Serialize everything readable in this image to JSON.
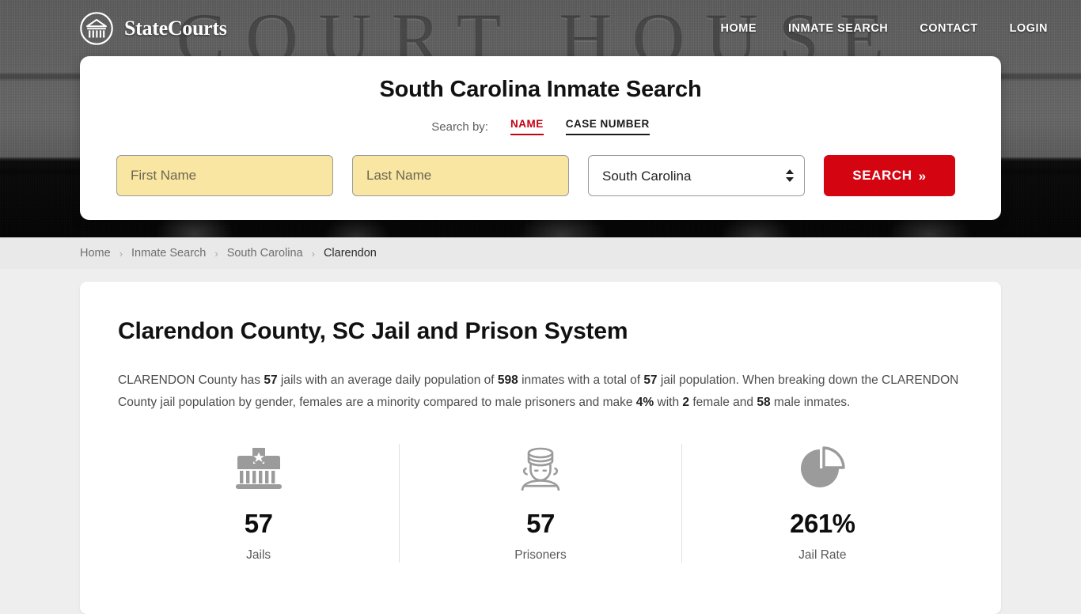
{
  "site": {
    "brand_name": "StateCourts",
    "logo_icon": "courthouse-circle-icon"
  },
  "nav": {
    "items": [
      {
        "label": "HOME"
      },
      {
        "label": "INMATE SEARCH"
      },
      {
        "label": "CONTACT"
      },
      {
        "label": "LOGIN"
      }
    ]
  },
  "search": {
    "title": "South Carolina Inmate Search",
    "search_by_label": "Search by:",
    "tabs": [
      {
        "label": "NAME",
        "active": true
      },
      {
        "label": "CASE NUMBER",
        "active": false
      }
    ],
    "first_name_placeholder": "First Name",
    "first_name_value": "",
    "last_name_placeholder": "Last Name",
    "last_name_value": "",
    "state_selected": "South Carolina",
    "state_options": [
      "South Carolina"
    ],
    "submit_label": "SEARCH",
    "submit_chevron": "»",
    "accent_color": "#d40511",
    "field_color": "#f9e6a2"
  },
  "breadcrumb": {
    "items": [
      {
        "label": "Home",
        "current": false
      },
      {
        "label": "Inmate Search",
        "current": false
      },
      {
        "label": "South Carolina",
        "current": false
      },
      {
        "label": "Clarendon",
        "current": true
      }
    ],
    "separator": "›"
  },
  "main": {
    "page_title": "Clarendon County, SC Jail and Prison System",
    "intro_parts": [
      {
        "text": "CLARENDON County has ",
        "bold": false
      },
      {
        "text": "57",
        "bold": true
      },
      {
        "text": " jails with an average daily population of ",
        "bold": false
      },
      {
        "text": "598",
        "bold": true
      },
      {
        "text": " inmates with a total of ",
        "bold": false
      },
      {
        "text": "57",
        "bold": true
      },
      {
        "text": " jail population. When breaking down the CLARENDON County jail population by gender, females are a minority compared to male prisoners and make ",
        "bold": false
      },
      {
        "text": "4%",
        "bold": true
      },
      {
        "text": " with ",
        "bold": false
      },
      {
        "text": "2",
        "bold": true
      },
      {
        "text": " female and ",
        "bold": false
      },
      {
        "text": "58",
        "bold": true
      },
      {
        "text": " male inmates.",
        "bold": false
      }
    ],
    "stats": [
      {
        "icon": "jail-building-icon",
        "value": "57",
        "label": "Jails"
      },
      {
        "icon": "prisoner-icon",
        "value": "57",
        "label": "Prisoners"
      },
      {
        "icon": "pie-chart-icon",
        "value": "261%",
        "label": "Jail Rate"
      }
    ]
  },
  "hero": {
    "background_lettering": "COURT HOUSE"
  }
}
